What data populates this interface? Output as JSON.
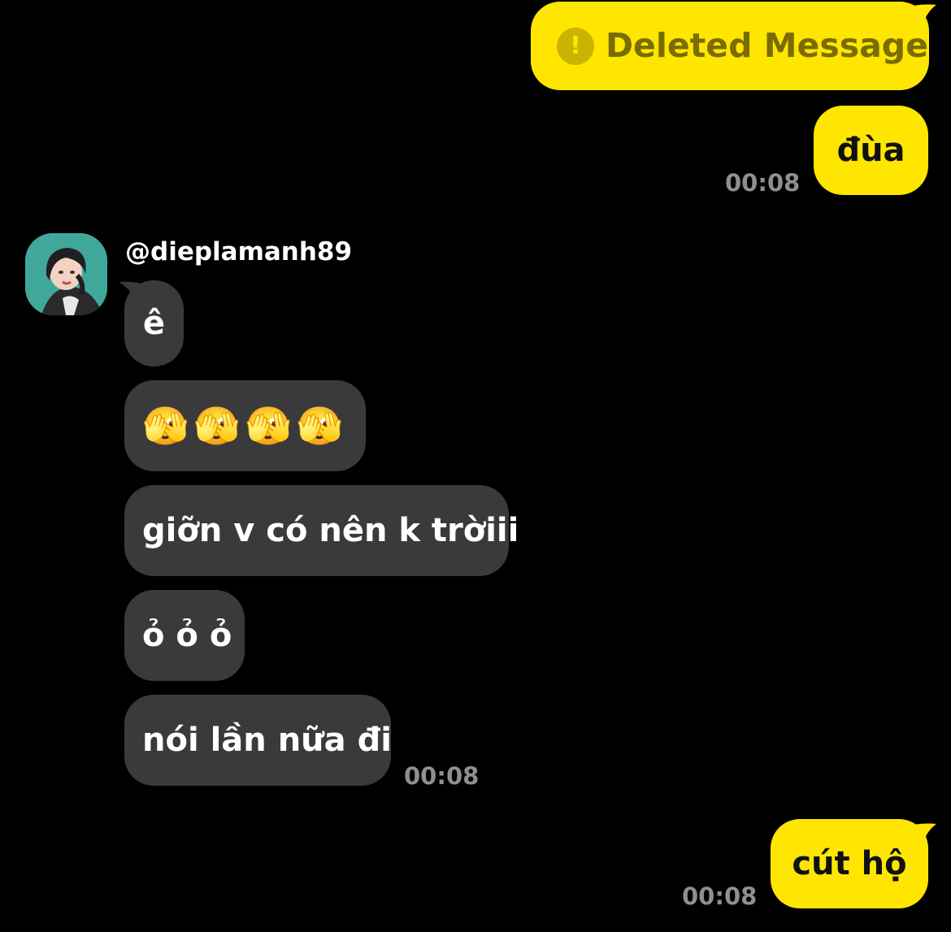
{
  "colors": {
    "background": "#000000",
    "outgoing_bubble": "#ffe600",
    "incoming_bubble": "#3a3a3c",
    "timestamp": "#8e8e93"
  },
  "messages": {
    "deleted": {
      "icon": "exclamation-circle-icon",
      "icon_glyph": "!",
      "text": "Deleted Message"
    },
    "out_1": {
      "text": "đùa",
      "time": "00:08"
    },
    "sender": {
      "username": "@dieplamanh89",
      "avatar_icon": "profile-photo"
    },
    "in_1": {
      "text": "ê"
    },
    "in_2": {
      "text": "🫣🫣🫣🫣"
    },
    "in_3": {
      "text": "giỡn v có nên k trờiii"
    },
    "in_4": {
      "text": "ỏ ỏ ỏ"
    },
    "in_5": {
      "text": "nói lần nữa đi",
      "time": "00:08"
    },
    "out_2": {
      "text": "cút hộ",
      "time": "00:08"
    }
  }
}
